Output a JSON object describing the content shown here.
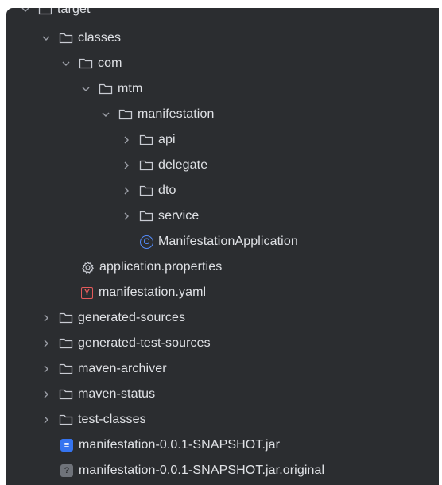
{
  "tree": {
    "target": "target",
    "classes": "classes",
    "com": "com",
    "mtm": "mtm",
    "manifestation": "manifestation",
    "api": "api",
    "delegate": "delegate",
    "dto": "dto",
    "service": "service",
    "main_class": "ManifestationApplication",
    "properties_file": "application.properties",
    "yaml_file": "manifestation.yaml",
    "generated_sources": "generated-sources",
    "generated_test_sources": "generated-test-sources",
    "maven_archiver": "maven-archiver",
    "maven_status": "maven-status",
    "test_classes": "test-classes",
    "jar_file": "manifestation-0.0.1-SNAPSHOT.jar",
    "jar_original": "manifestation-0.0.1-SNAPSHOT.jar.original"
  },
  "icons": {
    "class_glyph": "C",
    "yaml_glyph": "Y",
    "jar_glyph": "≡",
    "unknown_glyph": "?"
  },
  "colors": {
    "background": "#2b2d30",
    "text": "#dfe1e5",
    "chevron": "#9da0a8",
    "folder": "#c9ccd3",
    "class_icon": "#548af7",
    "yaml_icon": "#e55b5b",
    "jar_icon": "#3574f0"
  }
}
